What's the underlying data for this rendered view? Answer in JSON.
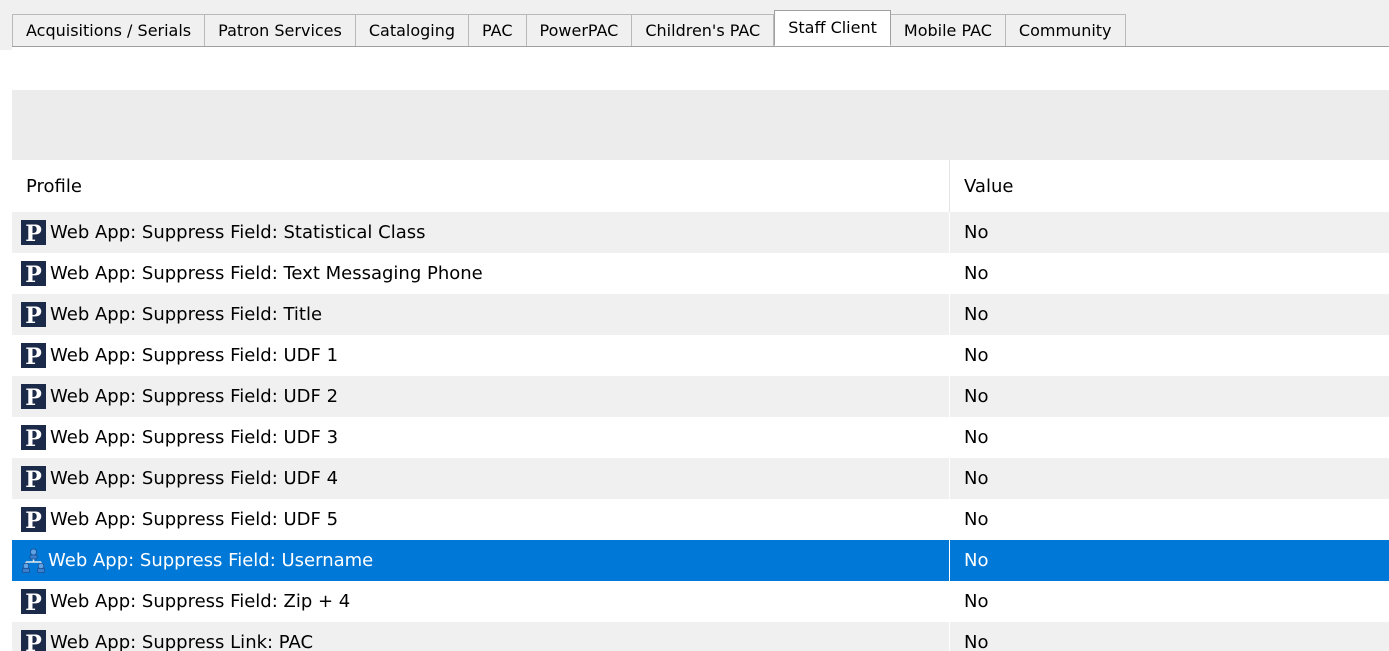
{
  "tabs": [
    {
      "label": "Acquisitions / Serials",
      "active": false
    },
    {
      "label": "Patron Services",
      "active": false
    },
    {
      "label": "Cataloging",
      "active": false
    },
    {
      "label": "PAC",
      "active": false
    },
    {
      "label": "PowerPAC",
      "active": false
    },
    {
      "label": "Children's PAC",
      "active": false
    },
    {
      "label": "Staff Client",
      "active": true
    },
    {
      "label": "Mobile PAC",
      "active": false
    },
    {
      "label": "Community",
      "active": false
    }
  ],
  "grid": {
    "columns": {
      "profile": "Profile",
      "value": "Value"
    },
    "rows": [
      {
        "profile": "Web App: Suppress Field: Statistical Class",
        "value": "No",
        "icon": "polaris-p-icon",
        "selected": false
      },
      {
        "profile": "Web App: Suppress Field: Text Messaging Phone",
        "value": "No",
        "icon": "polaris-p-icon",
        "selected": false
      },
      {
        "profile": "Web App: Suppress Field: Title",
        "value": "No",
        "icon": "polaris-p-icon",
        "selected": false
      },
      {
        "profile": "Web App: Suppress Field: UDF 1",
        "value": "No",
        "icon": "polaris-p-icon",
        "selected": false
      },
      {
        "profile": "Web App: Suppress Field: UDF 2",
        "value": "No",
        "icon": "polaris-p-icon",
        "selected": false
      },
      {
        "profile": "Web App: Suppress Field: UDF 3",
        "value": "No",
        "icon": "polaris-p-icon",
        "selected": false
      },
      {
        "profile": "Web App: Suppress Field: UDF 4",
        "value": "No",
        "icon": "polaris-p-icon",
        "selected": false
      },
      {
        "profile": "Web App: Suppress Field: UDF 5",
        "value": "No",
        "icon": "polaris-p-icon",
        "selected": false
      },
      {
        "profile": "Web App: Suppress Field: Username",
        "value": "No",
        "icon": "org-hierarchy-icon",
        "selected": true
      },
      {
        "profile": "Web App: Suppress Field: Zip + 4",
        "value": "No",
        "icon": "polaris-p-icon",
        "selected": false
      },
      {
        "profile": "Web App: Suppress Link: PAC",
        "value": "No",
        "icon": "polaris-p-icon",
        "selected": false
      }
    ]
  },
  "colors": {
    "selection": "#0078d7",
    "row_alt": "#f0f0f0",
    "toolbar_grey": "#ececec",
    "polaris_icon_bg": "#1c2a4a"
  }
}
